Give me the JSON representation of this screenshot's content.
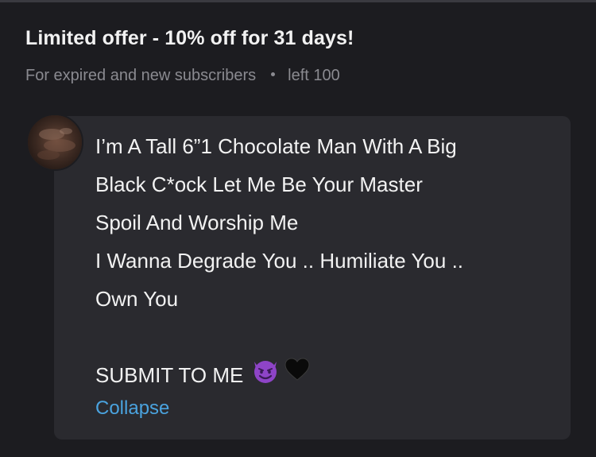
{
  "offer": {
    "title": "Limited offer - 10% off for 31 days!",
    "subtitle": "For expired and new subscribers",
    "remaining": "left 100"
  },
  "message": {
    "lines": [
      "I’m A Tall 6”1 Chocolate Man With A Big",
      "Black C*ock Let Me Be Your Master",
      "Spoil And Worship Me",
      "I Wanna Degrade You .. Humiliate You ..",
      "Own You"
    ],
    "closing": "SUBMIT TO ME",
    "emojis": [
      "smiling-devil-icon",
      "black-heart-icon"
    ],
    "collapse_label": "Collapse"
  },
  "colors": {
    "background": "#1c1c20",
    "card": "#2a2a2f",
    "text": "#f2f2f2",
    "muted": "#8a8a90",
    "link": "#4aa3df",
    "devil": "#8e44c7"
  }
}
